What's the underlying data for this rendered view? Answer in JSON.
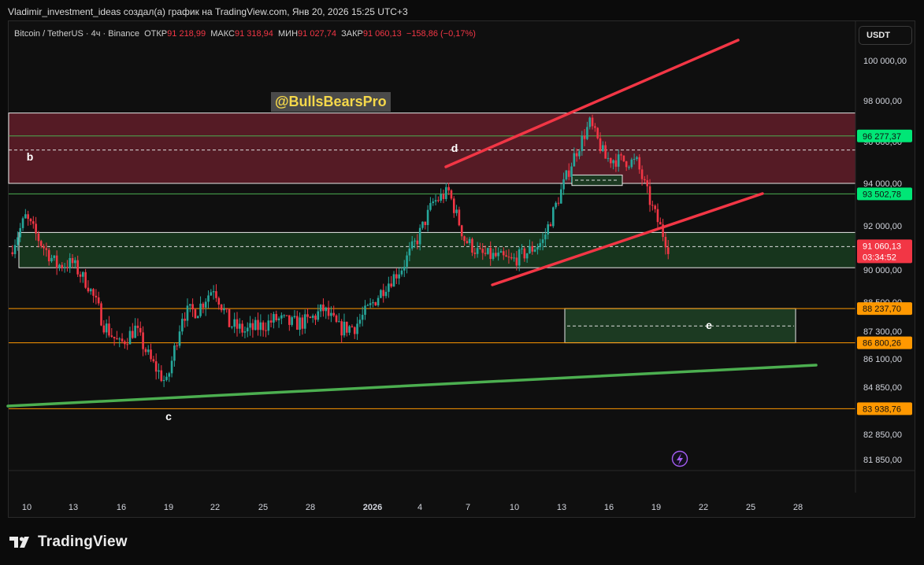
{
  "header": {
    "text": "Vladimir_investment_ideas создал(а) график на TradingView.com, Янв 20, 2026 15:25 UTC+3"
  },
  "legend": {
    "symbol": "Bitcoin / TetherUS · 4ч · Binance",
    "open_label": "ОТКР",
    "open_value": "91 218,99",
    "high_label": "МАКС",
    "high_value": "91 318,94",
    "low_label": "МИН",
    "low_value": "91 027,74",
    "close_label": "ЗАКР",
    "close_value": "91 060,13",
    "change": "−158,86 (−0,17%)"
  },
  "currency_button": "USDT",
  "watermark": "@BullsBearsPro",
  "brand": "TradingView",
  "colors": {
    "up": "#26a69a",
    "down": "#f23645",
    "accent_green": "#00e676",
    "orange": "#ff9800",
    "red_line": "#f23645"
  },
  "chart_data": {
    "type": "candlestick",
    "symbol": "BTC/USDT",
    "timeframe": "4ч",
    "x_ticks": [
      "10",
      "13",
      "16",
      "19",
      "22",
      "25",
      "28",
      "2026",
      "4",
      "7",
      "10",
      "13",
      "16",
      "19",
      "22",
      "25",
      "28"
    ],
    "y_ticks": [
      "100 000,00",
      "98 000,00",
      "96 000,00",
      "94 000,00",
      "92 000,00",
      "90 000,00",
      "88 500,00",
      "87 300,00",
      "86 100,00",
      "84 850,00",
      "82 850,00",
      "81 850,00"
    ],
    "price_labels": [
      {
        "value": "96 277,37",
        "type": "green"
      },
      {
        "value": "93 502,78",
        "type": "green"
      },
      {
        "value": "91 060,13",
        "sub": "03:34:52",
        "type": "current"
      },
      {
        "value": "88 237,70",
        "type": "orange"
      },
      {
        "value": "86 800,26",
        "type": "orange"
      },
      {
        "value": "83 938,76",
        "type": "orange"
      }
    ],
    "annotations": [
      "b",
      "c",
      "d",
      "e"
    ],
    "close_path": [
      [
        "2025-12-09",
        90800
      ],
      [
        "2025-12-10",
        92400
      ],
      [
        "2025-12-11",
        91200
      ],
      [
        "2025-12-12",
        90200
      ],
      [
        "2025-12-13",
        90300
      ],
      [
        "2025-12-14",
        89300
      ],
      [
        "2025-12-15",
        87600
      ],
      [
        "2025-12-16",
        86700
      ],
      [
        "2025-12-17",
        87400
      ],
      [
        "2025-12-18",
        86000
      ],
      [
        "2025-12-19",
        85000
      ],
      [
        "2025-12-20",
        88000
      ],
      [
        "2025-12-21",
        88200
      ],
      [
        "2025-12-22",
        89200
      ],
      [
        "2025-12-23",
        87600
      ],
      [
        "2025-12-24",
        87300
      ],
      [
        "2025-12-25",
        87500
      ],
      [
        "2025-12-26",
        87800
      ],
      [
        "2025-12-27",
        87600
      ],
      [
        "2025-12-28",
        87700
      ],
      [
        "2025-12-29",
        88200
      ],
      [
        "2025-12-30",
        87400
      ],
      [
        "2025-12-31",
        87500
      ],
      [
        "2026-01-01",
        88300
      ],
      [
        "2026-01-02",
        89300
      ],
      [
        "2026-01-03",
        90100
      ],
      [
        "2026-01-04",
        91400
      ],
      [
        "2026-01-05",
        93100
      ],
      [
        "2026-01-06",
        93600
      ],
      [
        "2026-01-07",
        91400
      ],
      [
        "2026-01-08",
        90700
      ],
      [
        "2026-01-09",
        90600
      ],
      [
        "2026-01-10",
        90400
      ],
      [
        "2026-01-11",
        90800
      ],
      [
        "2026-01-12",
        91300
      ],
      [
        "2026-01-13",
        93300
      ],
      [
        "2026-01-14",
        95300
      ],
      [
        "2026-01-15",
        96900
      ],
      [
        "2026-01-16",
        95200
      ],
      [
        "2026-01-17",
        95100
      ],
      [
        "2026-01-18",
        95000
      ],
      [
        "2026-01-19",
        92800
      ],
      [
        "2026-01-20",
        91060
      ]
    ],
    "ylim": [
      80800,
      101500
    ]
  }
}
